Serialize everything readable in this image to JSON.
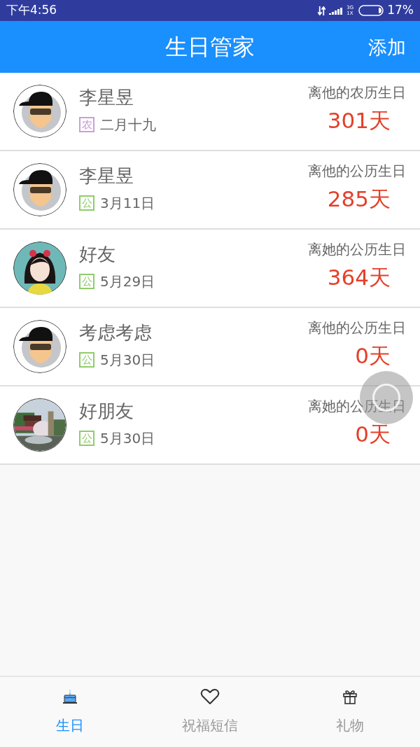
{
  "status_bar": {
    "time": "下午4:56",
    "network": "3G 1X",
    "battery": "17%"
  },
  "header": {
    "title": "生日管家",
    "action": "添加"
  },
  "contacts": [
    {
      "name": "李星昱",
      "avatar": {
        "kind": "man"
      },
      "calendar": {
        "mark": "农",
        "color": "#c9a0d6"
      },
      "date": "二月十九",
      "label": "离他的农历生日",
      "days": "301天"
    },
    {
      "name": "李星昱",
      "avatar": {
        "kind": "man"
      },
      "calendar": {
        "mark": "公",
        "color": "#8fcc6a"
      },
      "date": "3月11日",
      "label": "离他的公历生日",
      "days": "285天"
    },
    {
      "name": "好友",
      "avatar": {
        "kind": "girl"
      },
      "calendar": {
        "mark": "公",
        "color": "#8fcc6a"
      },
      "date": "5月29日",
      "label": "离她的公历生日",
      "days": "364天"
    },
    {
      "name": "考虑考虑",
      "avatar": {
        "kind": "man"
      },
      "calendar": {
        "mark": "公",
        "color": "#8fcc6a"
      },
      "date": "5月30日",
      "label": "离他的公历生日",
      "days": "0天"
    },
    {
      "name": "好朋友",
      "calendar": {
        "mark": "公",
        "color": "#8fcc6a"
      },
      "date": "5月30日",
      "label": "离她的公历生日",
      "days": "0天"
    }
  ],
  "tabs": [
    {
      "label": "生日",
      "kind": "cake",
      "selected": true
    },
    {
      "label": "祝福短信",
      "kind": "heart",
      "selected": false
    },
    {
      "label": "礼物",
      "kind": "gift",
      "selected": false
    }
  ]
}
